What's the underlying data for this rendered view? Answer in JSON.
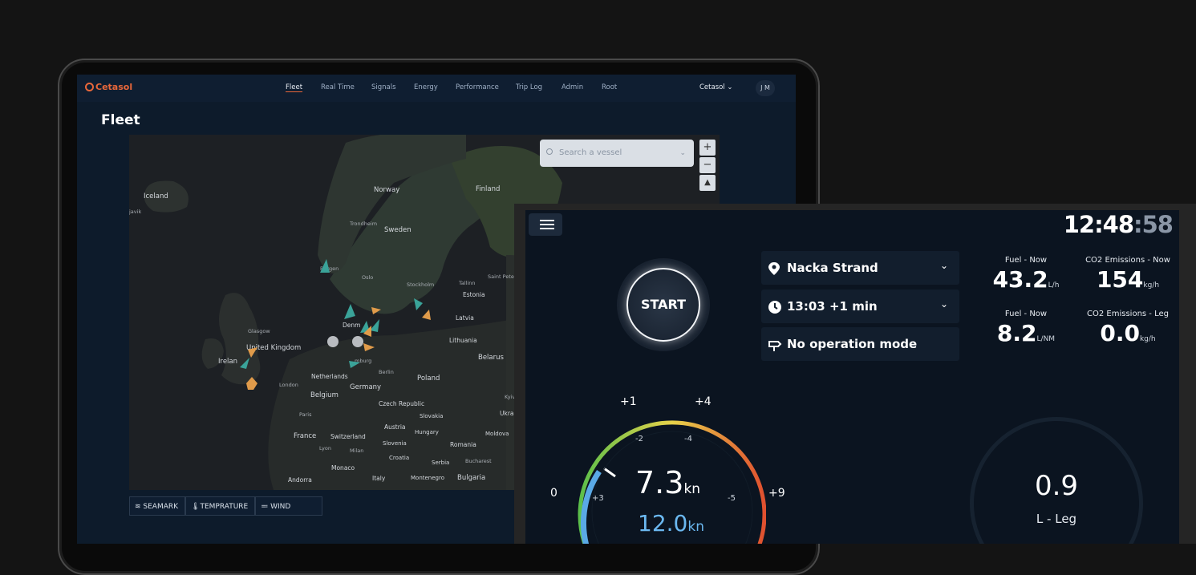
{
  "laptop": {
    "brand": "Cetasol",
    "nav": [
      "Fleet",
      "Real Time",
      "Signals",
      "Energy",
      "Performance",
      "Trip Log",
      "Admin",
      "Root"
    ],
    "active_nav": "Fleet",
    "account": "Cetasol",
    "user_initials": "J M",
    "page_title": "Fleet",
    "search_placeholder": "Search a vessel",
    "zoom_in": "+",
    "zoom_out": "−",
    "map_labels": {
      "iceland": "Iceland",
      "reykjavik": "javik",
      "norway": "Norway",
      "finland": "Finland",
      "trondheim": "Trondheim",
      "sweden": "Sweden",
      "bergen": "Bergen",
      "oslo": "Oslo",
      "stockholm": "Stockholm",
      "tallinn": "Tallinn",
      "st_petersburg": "Saint Peter",
      "estonia": "Estonia",
      "latvia": "Latvia",
      "lithuania": "Lithuania",
      "belarus": "Belarus",
      "denmark": "Denm",
      "glasgow": "Glasgow",
      "uk": "United Kingdom",
      "ireland": "Irelan",
      "london": "London",
      "netherlands": "Netherlands",
      "hamburg": "mburg",
      "berlin": "Berlin",
      "poland": "Poland",
      "germany": "Germany",
      "belgium": "Belgium",
      "czech": "Czech Republic",
      "kyiv": "Kyiv",
      "ukraine": "Ukra",
      "paris": "Paris",
      "slovakia": "Slovakia",
      "austria": "Austria",
      "hungary": "Hungary",
      "moldova": "Moldova",
      "france": "France",
      "switzerland": "Switzerland",
      "lyon": "Lyon",
      "milan": "Milan",
      "slovenia": "Slovenia",
      "romania": "Romania",
      "croatia": "Croatia",
      "bucharest": "Bucharest",
      "serbia": "Serbia",
      "monaco": "Monaco",
      "andorra": "Andorra",
      "italy": "Italy",
      "montenegro": "Montenegro",
      "bulgaria": "Bulgaria"
    },
    "layers": [
      "SEAMARK",
      "TEMPRATURE",
      "WIND"
    ]
  },
  "tablet": {
    "clock_hm": "12:48",
    "clock_sec": ":58",
    "start_label": "START",
    "location": "Nacka Strand",
    "departure": "13:03 +1 min",
    "mode": "No operation mode",
    "stats": [
      {
        "label": "Fuel - Now",
        "value": "43.2",
        "unit": "L/h"
      },
      {
        "label": "CO2 Emissions - Now",
        "value": "154",
        "unit": "kg/h"
      },
      {
        "label": "Fuel - Now",
        "value": "8.2",
        "unit": "L/NM"
      },
      {
        "label": "CO2 Emissions - Leg",
        "value": "0.0",
        "unit": "kg/h"
      }
    ],
    "gauge": {
      "outer_ticks": [
        "+1",
        "+4",
        "0",
        "+9"
      ],
      "inner_ticks": [
        "-2",
        "-4",
        "+3",
        "-5"
      ],
      "speed": "7.3",
      "speed_unit": "kn",
      "target_speed": "12.0",
      "target_unit": "kn"
    },
    "leg": {
      "value": "0.9",
      "label": "L - Leg"
    },
    "colors": {
      "accent": "#e8673a",
      "teal": "#3aa399",
      "orange": "#e09b4a",
      "blue": "#6bb8f0"
    }
  }
}
